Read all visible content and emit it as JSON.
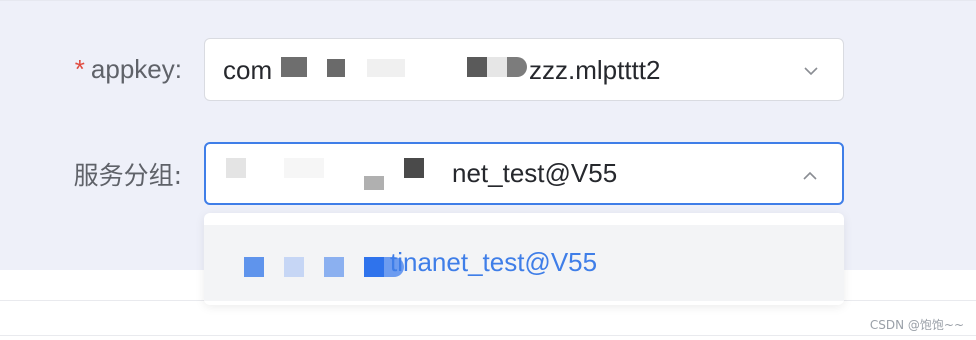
{
  "form": {
    "appkey": {
      "required_mark": "*",
      "label": "appkey:",
      "value_prefix": "com",
      "value_suffix": "zzz.mlptttt2",
      "dropdown_icon": "chevron-down-icon"
    },
    "service_group": {
      "label": "服务分组:",
      "value_suffix": "net_test@V55",
      "dropdown_icon": "chevron-up-icon",
      "open": true
    }
  },
  "dropdown": {
    "options": [
      {
        "label_suffix": "tinanet_test@V55",
        "selected": true
      }
    ]
  },
  "colors": {
    "accent": "#3f7ee8",
    "required": "#e04a3f",
    "panel_bg": "#eef0f9"
  },
  "watermark": "CSDN @饱饱~~"
}
